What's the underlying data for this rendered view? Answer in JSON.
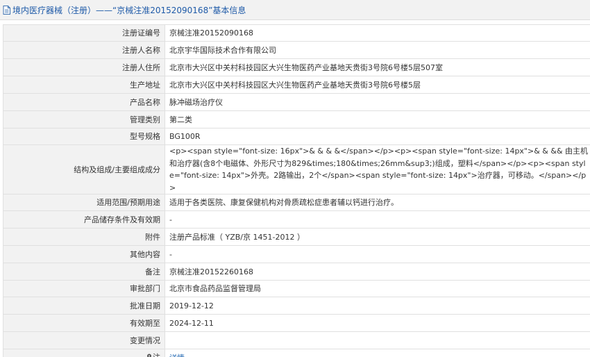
{
  "header": {
    "icon": "document-icon",
    "title": "境内医疗器械（注册）——“京械注准20152090168”基本信息"
  },
  "rows": [
    {
      "label": "注册证编号",
      "value": "京械注准20152090168"
    },
    {
      "label": "注册人名称",
      "value": "北京宇华国际技术合作有限公司"
    },
    {
      "label": "注册人住所",
      "value": "北京市大兴区中关村科技园区大兴生物医药产业基地天贵街3号院6号楼5层507室"
    },
    {
      "label": "生产地址",
      "value": "北京市大兴区中关村科技园区大兴生物医药产业基地天贵街3号院6号楼5层"
    },
    {
      "label": "产品名称",
      "value": "脉冲磁场治疗仪"
    },
    {
      "label": "管理类别",
      "value": "第二类"
    },
    {
      "label": "型号规格",
      "value": "BG100R"
    },
    {
      "label": "结构及组成/主要组成成分",
      "value": "<p><span style=\"font-size: 16px\">& & & &</span></p><p><span style=\"font-size: 14px\">& & && 由主机和治疗器(含8个电磁体、外形尺寸为829&times;180&times;26mm&sup3;)组成，塑料</span></p><p><span style=\"font-size: 14px\">外壳。2路输出，2个</span><span style=\"font-size: 14px\">治疗器，可移动。</span></p>"
    },
    {
      "label": "适用范围/预期用途",
      "value": "适用于各类医院、康复保健机构对骨质疏松症患者辅以钙进行治疗。"
    },
    {
      "label": "产品储存条件及有效期",
      "value": "-"
    },
    {
      "label": "附件",
      "value": "注册产品标准（ YZB/京 1451-2012 ）"
    },
    {
      "label": "其他内容",
      "value": "-"
    },
    {
      "label": "备注",
      "value": "京械注准20152260168"
    },
    {
      "label": "审批部门",
      "value": "北京市食品药品监督管理局"
    },
    {
      "label": "批准日期",
      "value": "2019-12-12"
    },
    {
      "label": "有效期至",
      "value": "2024-12-11"
    },
    {
      "label": "变更情况",
      "value": ""
    }
  ],
  "note": {
    "icon": "pin-icon",
    "label": "注",
    "link_text": "详情"
  },
  "colors": {
    "header_text": "#1e5aa8",
    "label_bg": "#f2f2f2",
    "border": "#e0e0e0",
    "link": "#2a6db5"
  }
}
